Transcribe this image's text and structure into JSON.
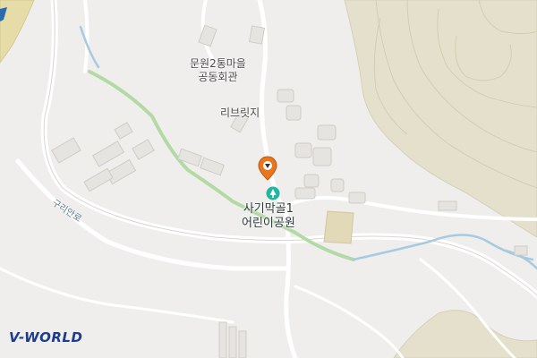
{
  "map": {
    "places": {
      "community_hall_line1": "문원2통마을",
      "community_hall_line2": "공동회관",
      "resort": "리브릿지",
      "park_line1": "사기막골1",
      "park_line2": "어린이공원"
    },
    "roads": {
      "main_road": "구리안로"
    },
    "logo": "V-WORLD",
    "colors": {
      "background": "#efeeec",
      "terrain": "#e3dfcc",
      "green_path": "#b6dca8",
      "stream": "#a8cde0",
      "marker": "#e8761c",
      "park_icon": "#22b5a0"
    },
    "icons": [
      "location-pin-icon",
      "park-tree-icon"
    ]
  }
}
